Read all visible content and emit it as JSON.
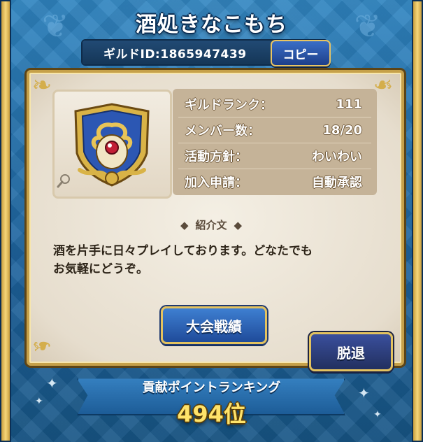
{
  "guild": {
    "name": "酒処きなこもち",
    "id_label": "ギルドID:1865947439",
    "copy_label": "コピー"
  },
  "info_rows": [
    {
      "label": "ギルドランク：",
      "value": "111"
    },
    {
      "label": "メンバー数：",
      "value": "18/20"
    },
    {
      "label": "活動方針：",
      "value": "わいわい"
    },
    {
      "label": "加入申請：",
      "value": "自動承認"
    }
  ],
  "intro": {
    "heading": "紹介文",
    "text_line1": "酒を片手に日々プレイしております。どなたでも",
    "text_line2": "お気軽にどうぞ。"
  },
  "buttons": {
    "tournament": "大会戦績",
    "leave": "脱退"
  },
  "ranking": {
    "label": "貢献ポイントランキング",
    "rank": "494位"
  },
  "colors": {
    "accent_gold": "#e3c25f",
    "rank_yellow": "#ffe36a",
    "panel_bg": "#e6ddcd",
    "info_bg": "#c5b398"
  },
  "icons": {
    "guild_emblem": "shield-emblem-icon",
    "zoom": "magnifier-icon"
  }
}
